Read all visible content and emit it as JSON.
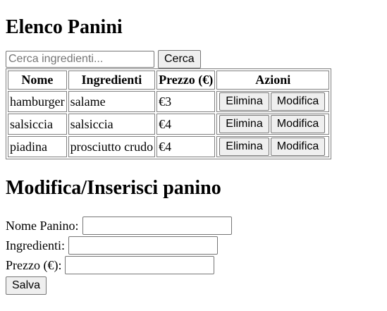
{
  "page": {
    "list_title": "Elenco Panini",
    "form_title": "Modifica/Inserisci panino"
  },
  "search": {
    "placeholder": "Cerca ingredienti...",
    "value": "",
    "button_label": "Cerca"
  },
  "table": {
    "headers": {
      "nome": "Nome",
      "ingredienti": "Ingredienti",
      "prezzo": "Prezzo (€)",
      "azioni": "Azioni"
    },
    "delete_label": "Elimina",
    "edit_label": "Modifica",
    "rows": [
      {
        "nome": "hamburger",
        "ingredienti": "salame",
        "prezzo": "€3"
      },
      {
        "nome": "salsiccia",
        "ingredienti": "salsiccia",
        "prezzo": "€4"
      },
      {
        "nome": "piadina",
        "ingredienti": "prosciutto crudo",
        "prezzo": "€4"
      }
    ]
  },
  "form": {
    "nome_label": "Nome Panino:",
    "nome_value": "",
    "ingredienti_label": "Ingredienti:",
    "ingredienti_value": "",
    "prezzo_label": "Prezzo (€):",
    "prezzo_value": "",
    "save_label": "Salva"
  }
}
